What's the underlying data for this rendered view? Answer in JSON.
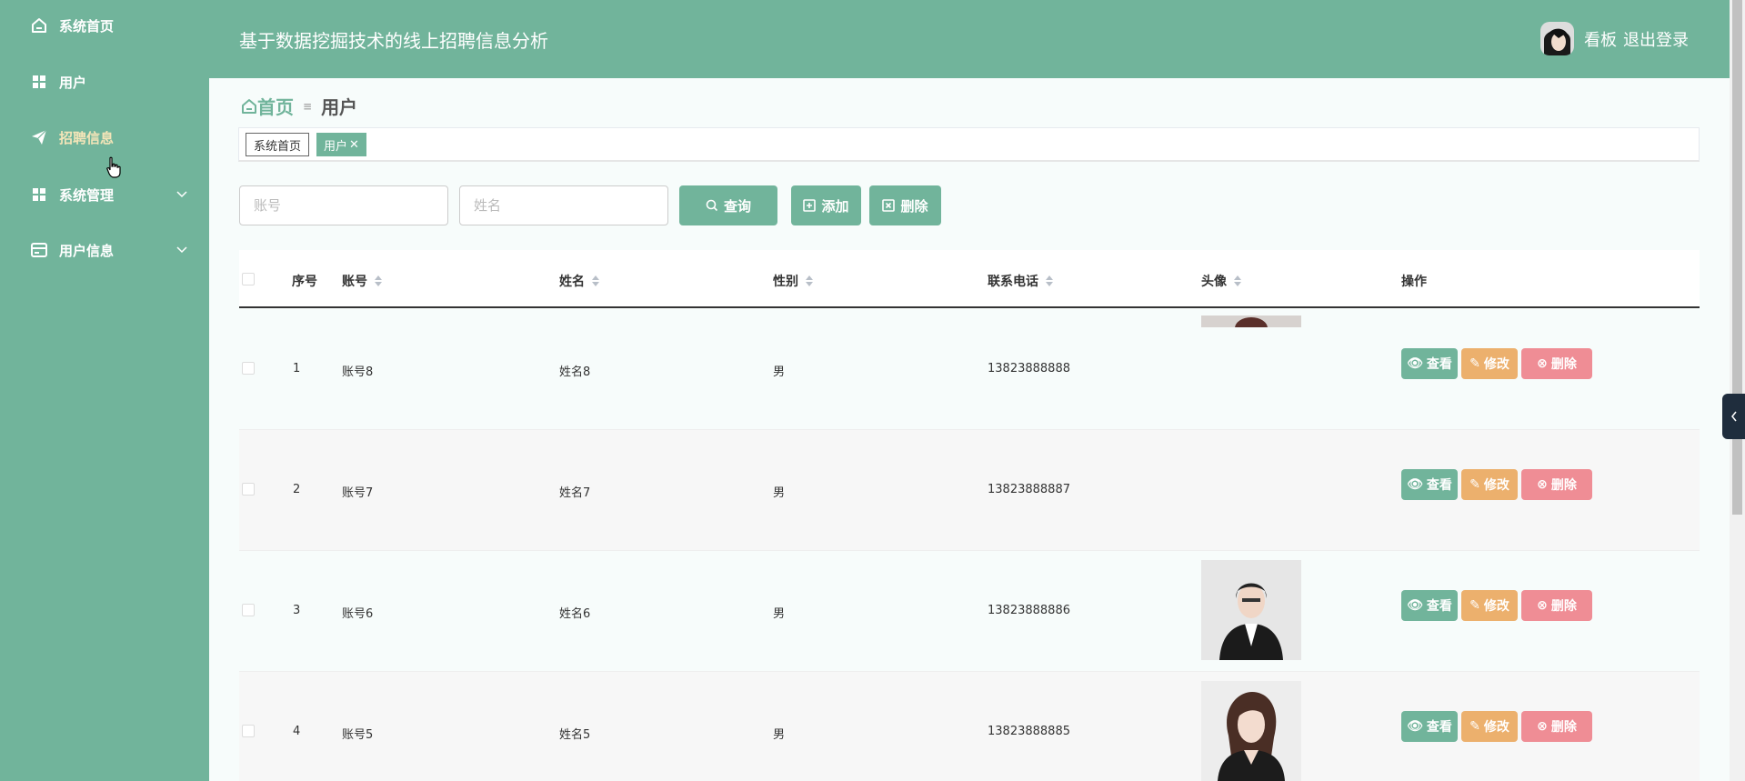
{
  "app": {
    "title": "基于数据挖掘技术的线上招聘信息分析"
  },
  "sidebar": {
    "items": [
      {
        "label": "系统首页",
        "icon": "home-icon"
      },
      {
        "label": "用户",
        "icon": "grid-icon"
      },
      {
        "label": "招聘信息",
        "icon": "paper-plane-icon"
      },
      {
        "label": "系统管理",
        "icon": "grid-icon"
      },
      {
        "label": "用户信息",
        "icon": "card-icon"
      }
    ]
  },
  "header": {
    "dashboard_label": "看板",
    "logout_label": "退出登录"
  },
  "breadcrumb": {
    "home": "首页",
    "separator": "≡",
    "current": "用户"
  },
  "tags": {
    "home": "系统首页",
    "active": "用户"
  },
  "search": {
    "account_placeholder": "账号",
    "name_placeholder": "姓名",
    "query_label": "查询",
    "add_label": "添加",
    "delete_label": "删除"
  },
  "table": {
    "columns": [
      "序号",
      "账号",
      "姓名",
      "性别",
      "联系电话",
      "头像",
      "操作"
    ],
    "rows": [
      {
        "index": "1",
        "account": "账号8",
        "name": "姓名8",
        "gender": "男",
        "phone": "13823888888"
      },
      {
        "index": "2",
        "account": "账号7",
        "name": "姓名7",
        "gender": "男",
        "phone": "13823888887"
      },
      {
        "index": "3",
        "account": "账号6",
        "name": "姓名6",
        "gender": "男",
        "phone": "13823888886"
      },
      {
        "index": "4",
        "account": "账号5",
        "name": "姓名5",
        "gender": "男",
        "phone": "13823888885"
      }
    ],
    "actions": {
      "view": "查看",
      "edit": "修改",
      "delete": "删除"
    }
  },
  "colors": {
    "primary": "#71b49b",
    "edit": "#ecb06d",
    "delete": "#ef8d95",
    "active_nav_text": "#f4e5b8"
  }
}
